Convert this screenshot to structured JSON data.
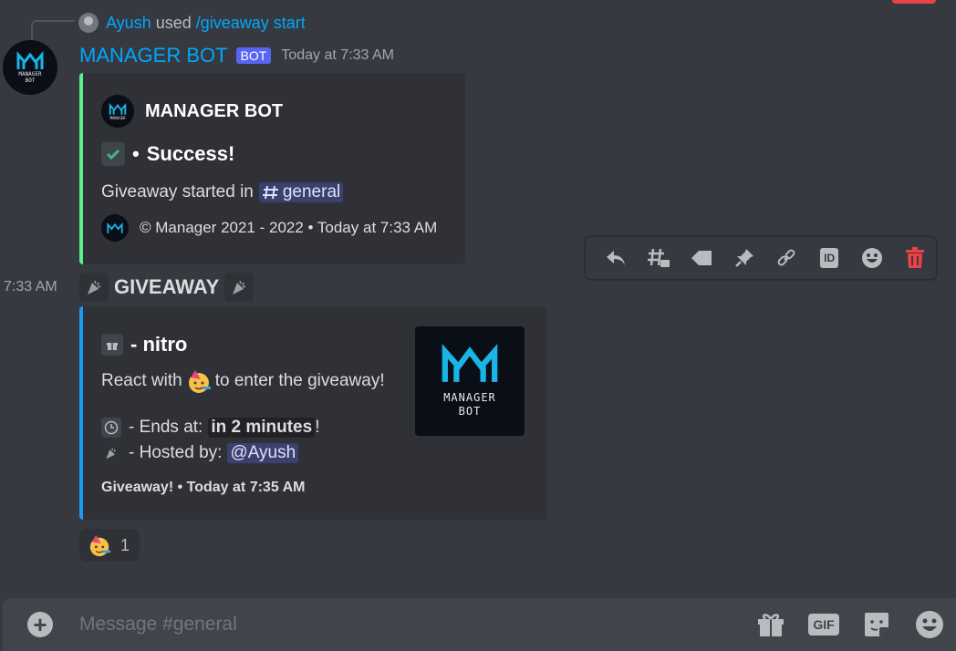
{
  "reply": {
    "user": "Ayush",
    "verb": "used",
    "command": "/giveaway start"
  },
  "message1": {
    "author": "MANAGER BOT",
    "bot_tag": "BOT",
    "timestamp": "Today at 7:33 AM",
    "embed": {
      "author": "MANAGER BOT",
      "title": "Success!",
      "title_prefix": "•",
      "description_prefix": "Giveaway started in",
      "channel_mention": "general",
      "footer": "© Manager 2021 - 2022 • Today at 7:33 AM",
      "color": "#57f287"
    }
  },
  "logo": {
    "line1": "MANAGER",
    "line2": "BOT"
  },
  "toolbar": {
    "icons": [
      "reply-icon",
      "create-thread-icon",
      "tag-icon",
      "pin-icon",
      "copy-link-icon",
      "copy-id-icon",
      "add-reaction-icon",
      "delete-icon"
    ],
    "id_label": "ID"
  },
  "message2": {
    "time": "7:33 AM",
    "content": "GIVEAWAY",
    "embed": {
      "title": "- nitro",
      "react_prefix": "React with",
      "react_suffix": "to enter the giveaway!",
      "ends_label": "- Ends at:",
      "ends_value": "in 2 minutes",
      "ends_suffix": "!",
      "hosted_label": "- Hosted by:",
      "host_mention": "@Ayush",
      "footer": "Giveaway! • Today at 7:35 AM",
      "color": "#1d9bf0"
    },
    "reaction": {
      "emoji": "partying-face",
      "count": "1"
    }
  },
  "composer": {
    "placeholder": "Message #general",
    "gif_label": "GIF"
  }
}
